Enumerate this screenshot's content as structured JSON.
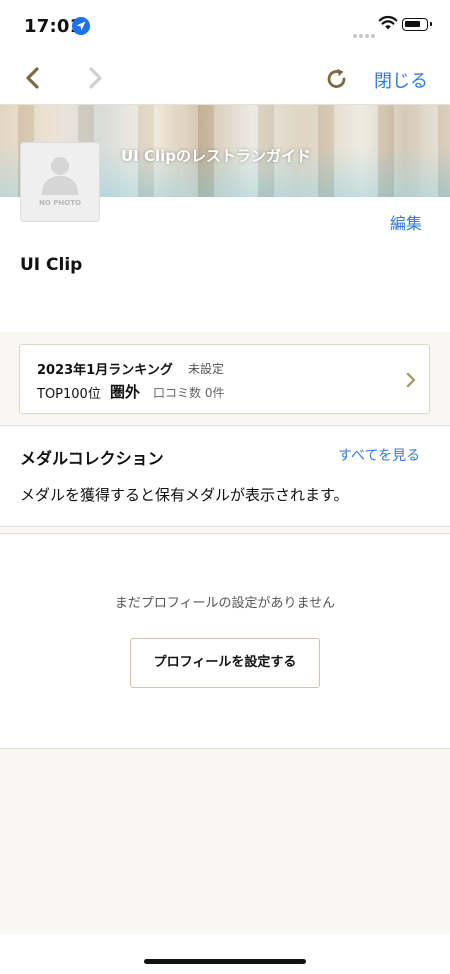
{
  "status": {
    "time": "17:01"
  },
  "nav": {
    "close_label": "閉じる"
  },
  "cover": {
    "title": "UI Clipのレストランガイド"
  },
  "profile": {
    "avatar_text": "NO PHOTO",
    "edit_label": "編集",
    "username": "UI Clip"
  },
  "ranking": {
    "title": "2023年1月ランキング",
    "status": "未設定",
    "top_label": "TOP100位",
    "top_value": "圏外",
    "reviews": "口コミ数 0件"
  },
  "medals": {
    "title": "メダルコレクション",
    "see_all": "すべてを見る",
    "description": "メダルを獲得すると保有メダルが表示されます。"
  },
  "profile_setup": {
    "empty_text": "まだプロフィールの設定がありません",
    "button_label": "プロフィールを設定する"
  },
  "colors": {
    "link": "#2f7bd6",
    "nav_icon": "#7a6a45",
    "border": "#dcd7c5",
    "background": "#f8f7f3"
  },
  "icons": [
    "location-arrow-icon",
    "wifi-icon",
    "battery-icon",
    "back-arrow-icon",
    "forward-arrow-icon",
    "reload-icon",
    "avatar-placeholder-icon",
    "chevron-right-icon"
  ]
}
